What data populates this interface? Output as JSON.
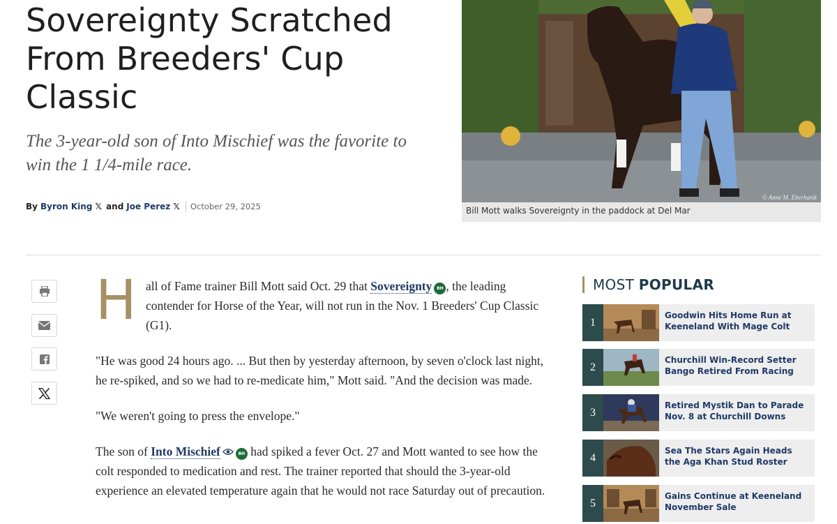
{
  "article": {
    "headline": "Sovereignty Scratched From Breeders' Cup Classic",
    "dek": "The 3-year-old son of Into Mischief was the favorite to win the 1 1/4-mile race.",
    "byline": {
      "by": "By",
      "author1": "Byron King",
      "and": "and",
      "author2": "Joe Perez",
      "x_glyph": "𝕏",
      "date": "October 29, 2025"
    },
    "photo_caption": "Bill Mott walks Sovereignty in the paddock at Del Mar",
    "photo_credit": "© Anne M. Eberhardt",
    "dropcap": "H",
    "p1_a": "all of Fame trainer Bill Mott said Oct. 29 that ",
    "p1_link": "Sovereignty",
    "p1_b": ", the leading contender for Horse of the Year, will not run in the Nov. 1 Breeders' Cup Classic (G1).",
    "p2": "\"He was good 24 hours ago. ... But then by yesterday afternoon, by seven o'clock last night, he re-spiked, and so we had to re-medicate him,\" Mott said. \"And the decision was made.",
    "p3": "\"We weren't going to press the envelope.\"",
    "p4_a": "The son of ",
    "p4_link": "Into Mischief",
    "p4_b": " had spiked a fever Oct. 27 and Mott wanted to see how the colt responded to medication and rest. The trainer reported that should the 3-year-old experience an elevated temperature again that he would not race Saturday out of precaution.",
    "badge": "BH"
  },
  "most_popular": {
    "title_light": "MOST",
    "title_bold": "POPULAR",
    "items": [
      {
        "num": "1",
        "title": "Goodwin Hits Home Run at Keeneland With Mage Colt"
      },
      {
        "num": "2",
        "title": "Churchill Win-Record Setter Bango Retired From Racing"
      },
      {
        "num": "3",
        "title": "Retired Mystik Dan to Parade Nov. 8 at Churchill Downs"
      },
      {
        "num": "4",
        "title": "Sea The Stars Again Heads the Aga Khan Stud Roster"
      },
      {
        "num": "5",
        "title": "Gains Continue at Keeneland November Sale"
      }
    ]
  },
  "colors": {
    "accent_gold": "#a69064",
    "link_navy": "#1f3a66",
    "popular_num_bg": "#2d4a4d",
    "bh_badge": "#1e6b3a"
  },
  "icons": [
    "print-icon",
    "email-icon",
    "facebook-icon",
    "x-icon"
  ]
}
